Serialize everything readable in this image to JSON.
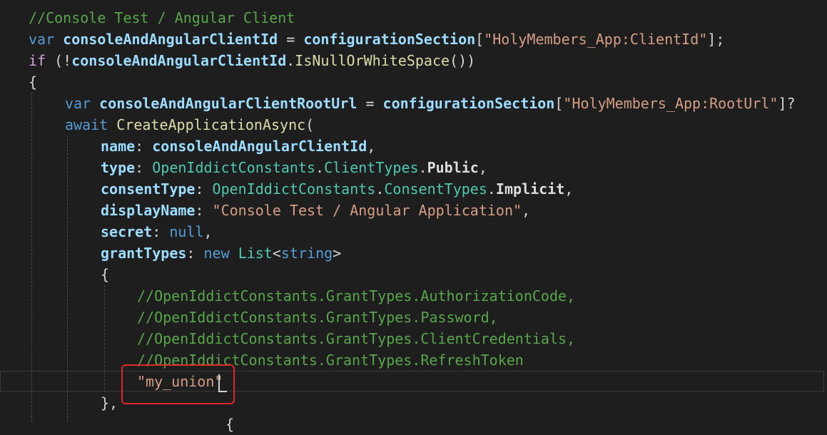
{
  "editor": {
    "lines": [
      [
        {
          "t": "cmt",
          "v": "//Console Test / Angular Client"
        }
      ],
      [
        {
          "t": "kw",
          "v": "var"
        },
        {
          "t": "plain",
          "v": " "
        },
        {
          "t": "var",
          "v": "consoleAndAngularClientId"
        },
        {
          "t": "plain",
          "v": " = "
        },
        {
          "t": "var",
          "v": "configurationSection"
        },
        {
          "t": "plain",
          "v": "["
        },
        {
          "t": "str",
          "v": "\"HolyMembers_App:ClientId\""
        },
        {
          "t": "plain",
          "v": "];"
        }
      ],
      [
        {
          "t": "cf",
          "v": "if"
        },
        {
          "t": "plain",
          "v": " (!"
        },
        {
          "t": "var",
          "v": "consoleAndAngularClientId"
        },
        {
          "t": "plain",
          "v": "."
        },
        {
          "t": "method",
          "v": "IsNullOrWhiteSpace"
        },
        {
          "t": "plain",
          "v": "())"
        }
      ],
      [
        {
          "t": "plain",
          "v": "{"
        }
      ],
      [
        {
          "t": "kw",
          "v": "var"
        },
        {
          "t": "plain",
          "v": " "
        },
        {
          "t": "var",
          "v": "consoleAndAngularClientRootUrl"
        },
        {
          "t": "plain",
          "v": " = "
        },
        {
          "t": "var",
          "v": "configurationSection"
        },
        {
          "t": "plain",
          "v": "["
        },
        {
          "t": "str",
          "v": "\"HolyMembers_App:RootUrl\""
        },
        {
          "t": "plain",
          "v": "]?"
        }
      ],
      [
        {
          "t": "kw",
          "v": "await"
        },
        {
          "t": "plain",
          "v": " "
        },
        {
          "t": "method",
          "v": "CreateApplicationAsync"
        },
        {
          "t": "plain",
          "v": "("
        }
      ],
      [
        {
          "t": "var",
          "v": "name"
        },
        {
          "t": "plain",
          "v": ": "
        },
        {
          "t": "var",
          "v": "consoleAndAngularClientId"
        },
        {
          "t": "plain",
          "v": ","
        }
      ],
      [
        {
          "t": "var",
          "v": "type"
        },
        {
          "t": "plain",
          "v": ": "
        },
        {
          "t": "type",
          "v": "OpenIddictConstants"
        },
        {
          "t": "plain",
          "v": "."
        },
        {
          "t": "type",
          "v": "ClientTypes"
        },
        {
          "t": "plain",
          "v": "."
        },
        {
          "t": "ident",
          "v": "Public"
        },
        {
          "t": "plain",
          "v": ","
        }
      ],
      [
        {
          "t": "var",
          "v": "consentType"
        },
        {
          "t": "plain",
          "v": ": "
        },
        {
          "t": "type",
          "v": "OpenIddictConstants"
        },
        {
          "t": "plain",
          "v": "."
        },
        {
          "t": "type",
          "v": "ConsentTypes"
        },
        {
          "t": "plain",
          "v": "."
        },
        {
          "t": "ident",
          "v": "Implicit"
        },
        {
          "t": "plain",
          "v": ","
        }
      ],
      [
        {
          "t": "var",
          "v": "displayName"
        },
        {
          "t": "plain",
          "v": ": "
        },
        {
          "t": "str",
          "v": "\"Console Test / Angular Application\""
        },
        {
          "t": "plain",
          "v": ","
        }
      ],
      [
        {
          "t": "var",
          "v": "secret"
        },
        {
          "t": "plain",
          "v": ": "
        },
        {
          "t": "kw",
          "v": "null"
        },
        {
          "t": "plain",
          "v": ","
        }
      ],
      [
        {
          "t": "var",
          "v": "grantTypes"
        },
        {
          "t": "plain",
          "v": ": "
        },
        {
          "t": "kw",
          "v": "new"
        },
        {
          "t": "plain",
          "v": " "
        },
        {
          "t": "type",
          "v": "List"
        },
        {
          "t": "plain",
          "v": "<"
        },
        {
          "t": "kw",
          "v": "string"
        },
        {
          "t": "plain",
          "v": ">"
        }
      ],
      [
        {
          "t": "plain",
          "v": "{"
        }
      ],
      [
        {
          "t": "cmt",
          "v": "//OpenIddictConstants.GrantTypes.AuthorizationCode,"
        }
      ],
      [
        {
          "t": "cmt",
          "v": "//OpenIddictConstants.GrantTypes.Password,"
        }
      ],
      [
        {
          "t": "cmt",
          "v": "//OpenIddictConstants.GrantTypes.ClientCredentials,"
        }
      ],
      [
        {
          "t": "cmt",
          "v": "//OpenIddictConstants.GrantTypes.RefreshToken"
        }
      ],
      [
        {
          "t": "str",
          "v": "\"my_union\""
        }
      ],
      [
        {
          "t": "plain",
          "v": "},"
        }
      ],
      [
        {
          "t": "plain",
          "v": "{"
        }
      ]
    ]
  }
}
